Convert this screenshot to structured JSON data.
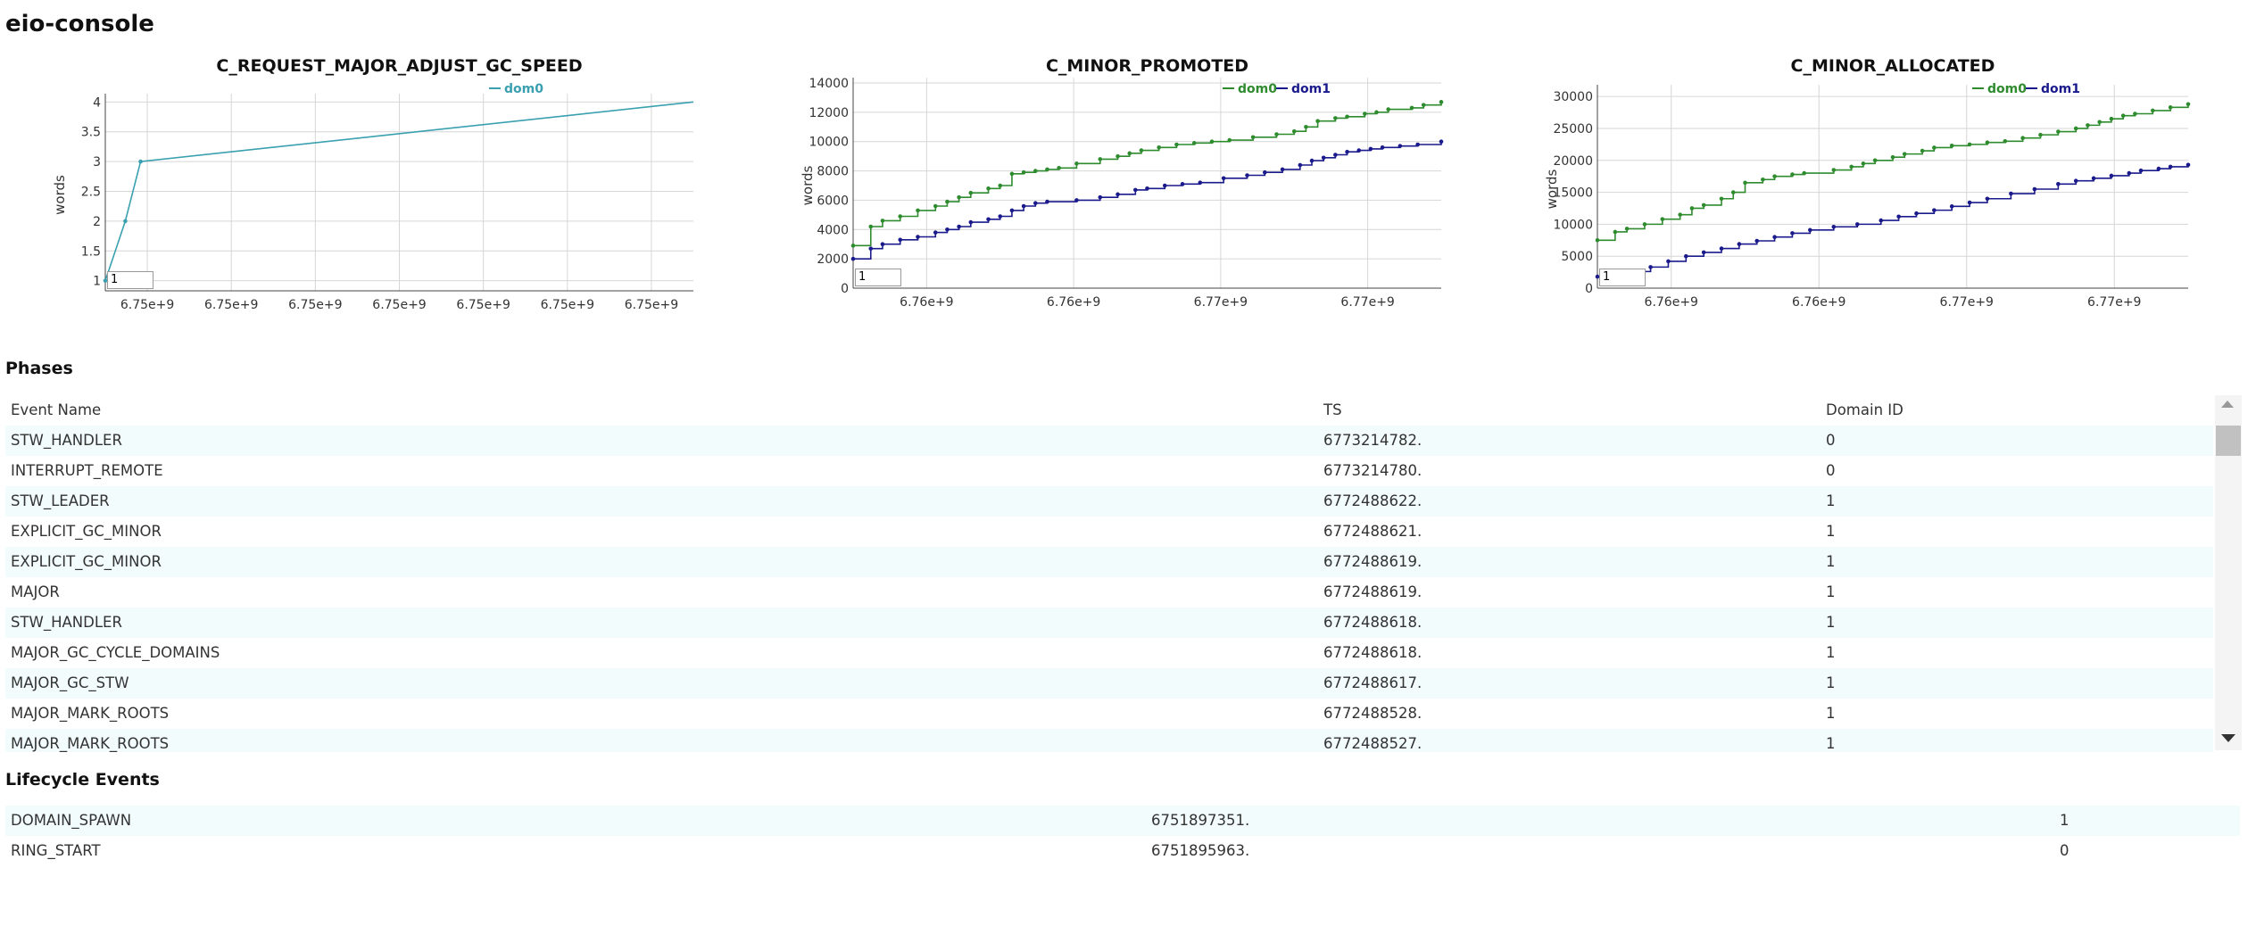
{
  "app": {
    "title": "eio-console"
  },
  "charts": [
    {
      "id": "c1",
      "chart_data": {
        "type": "line",
        "title": "C_REQUEST_MAJOR_ADJUST_GC_SPEED",
        "ylabel": "words",
        "xlabel": "",
        "x_tick_labels": [
          "6.75e+9",
          "6.75e+9",
          "6.75e+9",
          "6.75e+9",
          "6.75e+9",
          "6.75e+9",
          "6.75e+9"
        ],
        "y_ticks": [
          1,
          1.5,
          2,
          2.5,
          3,
          3.5,
          4
        ],
        "ylim": [
          0.83,
          4.05
        ],
        "xlim": [
          0,
          100
        ],
        "grid": true,
        "legend": "top-center",
        "zoom_input": "1",
        "series": [
          {
            "name": "dom0",
            "color": "#3aa0b0",
            "x": [
              0,
              3.4,
              6.0,
              100
            ],
            "y": [
              1,
              2,
              3,
              4
            ],
            "markers": [
              1,
              1,
              1,
              0
            ]
          }
        ]
      }
    },
    {
      "id": "c2",
      "chart_data": {
        "type": "line",
        "title": "C_MINOR_PROMOTED",
        "ylabel": "words",
        "xlabel": "",
        "x_tick_labels": [
          "6.76e+9",
          "6.76e+9",
          "6.77e+9",
          "6.77e+9"
        ],
        "y_ticks": [
          0,
          2000,
          4000,
          6000,
          8000,
          10000,
          12000,
          14000
        ],
        "ylim": [
          0,
          14000
        ],
        "xlim": [
          0,
          100
        ],
        "grid": true,
        "legend": "top-right",
        "zoom_input": "1",
        "series": [
          {
            "name": "dom0",
            "color": "#2e8b2e",
            "x": [
              0,
              3,
              5,
              8,
              11,
              14,
              16,
              18,
              20,
              23,
              25,
              27,
              29,
              31,
              33,
              35,
              38,
              42,
              45,
              47,
              49,
              52,
              55,
              58,
              61,
              64,
              68,
              72,
              75,
              77,
              79,
              82,
              84,
              87,
              89,
              91,
              95,
              97,
              100
            ],
            "y": [
              2900,
              4200,
              4600,
              4900,
              5300,
              5600,
              5900,
              6200,
              6500,
              6800,
              7000,
              7800,
              7900,
              8000,
              8100,
              8200,
              8500,
              8800,
              9000,
              9200,
              9400,
              9600,
              9800,
              9900,
              10000,
              10100,
              10300,
              10500,
              10700,
              11000,
              11400,
              11600,
              11700,
              11900,
              12000,
              12200,
              12300,
              12500,
              12700
            ]
          },
          {
            "name": "dom1",
            "color": "#1a1a8c",
            "x": [
              0,
              3,
              5,
              8,
              11,
              14,
              16,
              18,
              20,
              23,
              25,
              27,
              29,
              31,
              33,
              38,
              42,
              45,
              48,
              50,
              53,
              56,
              59,
              63,
              67,
              70,
              73,
              76,
              78,
              80,
              82,
              84,
              86,
              88,
              90,
              93,
              96,
              100
            ],
            "y": [
              2000,
              2700,
              3000,
              3300,
              3500,
              3800,
              4000,
              4200,
              4500,
              4700,
              4900,
              5300,
              5600,
              5800,
              5900,
              6000,
              6200,
              6400,
              6700,
              6800,
              7000,
              7100,
              7200,
              7500,
              7700,
              7900,
              8100,
              8400,
              8700,
              8900,
              9100,
              9300,
              9400,
              9500,
              9600,
              9700,
              9800,
              10000
            ]
          }
        ]
      }
    },
    {
      "id": "c3",
      "chart_data": {
        "type": "line",
        "title": "C_MINOR_ALLOCATED",
        "ylabel": "words",
        "xlabel": "",
        "x_tick_labels": [
          "6.76e+9",
          "6.76e+9",
          "6.77e+9",
          "6.77e+9"
        ],
        "y_ticks": [
          0,
          5000,
          10000,
          15000,
          20000,
          25000,
          30000
        ],
        "ylim": [
          0,
          31000
        ],
        "xlim": [
          0,
          100
        ],
        "grid": true,
        "legend": "top-right",
        "zoom_input": "1",
        "series": [
          {
            "name": "dom0",
            "color": "#2e8b2e",
            "x": [
              0,
              3,
              5,
              8,
              11,
              14,
              16,
              18,
              21,
              23,
              25,
              28,
              30,
              33,
              35,
              40,
              43,
              45,
              47,
              50,
              52,
              55,
              57,
              60,
              63,
              66,
              69,
              72,
              75,
              78,
              81,
              83,
              85,
              87,
              89,
              91,
              94,
              97,
              100
            ],
            "y": [
              7500,
              8800,
              9300,
              10000,
              10800,
              11500,
              12500,
              13000,
              14000,
              15000,
              16500,
              17000,
              17500,
              17800,
              18000,
              18500,
              19000,
              19500,
              20000,
              20500,
              21000,
              21500,
              22000,
              22300,
              22500,
              22800,
              23000,
              23500,
              24000,
              24500,
              25000,
              25500,
              26000,
              26500,
              27000,
              27300,
              27800,
              28300,
              28800
            ]
          },
          {
            "name": "dom1",
            "color": "#1a1a8c",
            "x": [
              0,
              3,
              6,
              9,
              12,
              15,
              18,
              21,
              24,
              27,
              30,
              33,
              36,
              40,
              44,
              48,
              51,
              54,
              57,
              60,
              63,
              66,
              70,
              74,
              78,
              81,
              84,
              87,
              90,
              92,
              95,
              97,
              100
            ],
            "y": [
              1800,
              2100,
              2600,
              3300,
              4200,
              5000,
              5600,
              6200,
              6900,
              7400,
              8000,
              8600,
              9100,
              9600,
              10000,
              10600,
              11200,
              11700,
              12200,
              12800,
              13400,
              14000,
              14800,
              15500,
              16300,
              16800,
              17200,
              17600,
              18000,
              18400,
              18700,
              19000,
              19300
            ]
          }
        ]
      }
    }
  ],
  "phases": {
    "title": "Phases",
    "columns": [
      "Event Name",
      "TS",
      "Domain ID"
    ],
    "rows": [
      [
        "STW_HANDLER",
        "6773214782.",
        "0"
      ],
      [
        "INTERRUPT_REMOTE",
        "6773214780.",
        "0"
      ],
      [
        "STW_LEADER",
        "6772488622.",
        "1"
      ],
      [
        "EXPLICIT_GC_MINOR",
        "6772488621.",
        "1"
      ],
      [
        "EXPLICIT_GC_MINOR",
        "6772488619.",
        "1"
      ],
      [
        "MAJOR",
        "6772488619.",
        "1"
      ],
      [
        "STW_HANDLER",
        "6772488618.",
        "1"
      ],
      [
        "MAJOR_GC_CYCLE_DOMAINS",
        "6772488618.",
        "1"
      ],
      [
        "MAJOR_GC_STW",
        "6772488617.",
        "1"
      ],
      [
        "MAJOR_MARK_ROOTS",
        "6772488528.",
        "1"
      ],
      [
        "MAJOR_MARK_ROOTS",
        "6772488527.",
        "1"
      ]
    ]
  },
  "lifecycle": {
    "title": "Lifecycle Events",
    "rows": [
      [
        "DOMAIN_SPAWN",
        "6751897351.",
        "1"
      ],
      [
        "RING_START",
        "6751895963.",
        "0"
      ]
    ]
  }
}
